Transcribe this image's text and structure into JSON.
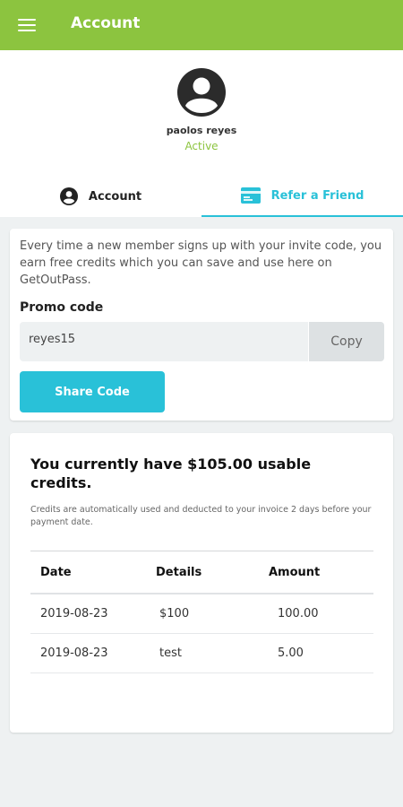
{
  "app": {
    "title": "Account"
  },
  "profile": {
    "name": "paolos reyes",
    "status": "Active"
  },
  "tabs": [
    {
      "label": "Account",
      "icon": "account-circle-icon",
      "selected": false
    },
    {
      "label": "Refer a Friend",
      "icon": "credit-card-icon",
      "selected": true
    }
  ],
  "refer": {
    "description": "Every time a new member signs up with your invite code, you earn free credits which you can save and use here on GetOutPass.",
    "promo_label": "Promo code",
    "promo_code": "reyes15",
    "copy_label": "Copy",
    "share_label": "Share Code"
  },
  "credits": {
    "title": "You currently have $105.00 usable credits.",
    "note": "Credits are automatically used and deducted to your invoice 2 days before your payment date.",
    "columns": [
      "Date",
      "Details",
      "Amount"
    ],
    "rows": [
      {
        "date": "2019-08-23",
        "details": "$100",
        "amount": "100.00"
      },
      {
        "date": "2019-08-23",
        "details": "test",
        "amount": "5.00"
      }
    ]
  },
  "colors": {
    "accent_green": "#8cc43f",
    "accent_cyan": "#29c1d8"
  }
}
